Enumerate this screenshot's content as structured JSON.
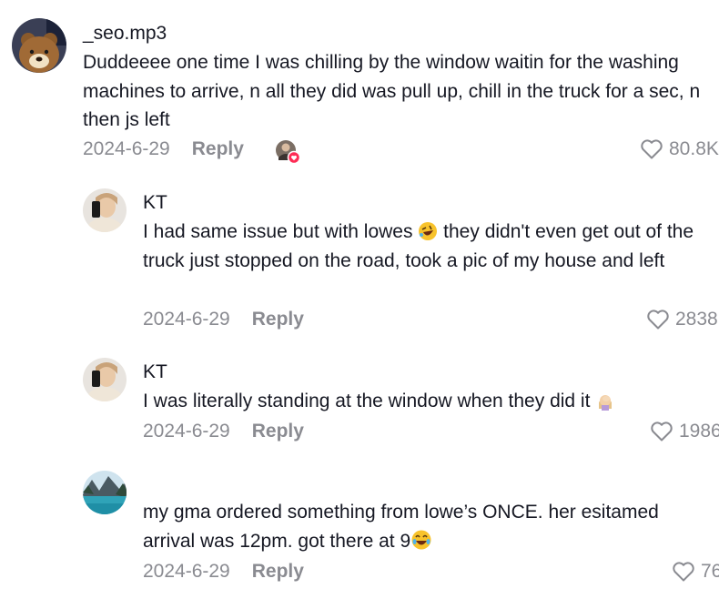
{
  "comments": [
    {
      "username": "_seo.mp3",
      "text": "Duddeeee one time I was chilling by the window waitin for the washing machines to arrive, n all they did was pull up, chill in the truck for a sec, n then js left",
      "date": "2024-6-29",
      "reply_label": "Reply",
      "likes": "80.8K",
      "avatar_icon": "bear-avatar"
    },
    {
      "username": "KT",
      "text_before_emoji": "I had same issue but with lowes ",
      "emoji": "rofl-emoji",
      "text_after_emoji": " they didn't even get out of the truck just stopped on the road, took a pic of my house and left",
      "date": "2024-6-29",
      "reply_label": "Reply",
      "likes": "2838",
      "avatar_icon": "selfie-avatar"
    },
    {
      "username": "KT",
      "text": "I was literally standing at the window when they did it ",
      "emoji": "facepalm-emoji",
      "date": "2024-6-29",
      "reply_label": "Reply",
      "likes": "1986",
      "avatar_icon": "selfie-avatar"
    },
    {
      "username": "",
      "text": "my gma ordered something from lowe’s ONCE. her esitamed arrival was 12pm. got there at 9",
      "emoji": "laughing-emoji",
      "date": "2024-6-29",
      "reply_label": "Reply",
      "likes": "76",
      "avatar_icon": "lake-avatar"
    }
  ],
  "colors": {
    "text": "#161823",
    "muted": "#8a8b91",
    "like_badge": "#fe2c55"
  }
}
